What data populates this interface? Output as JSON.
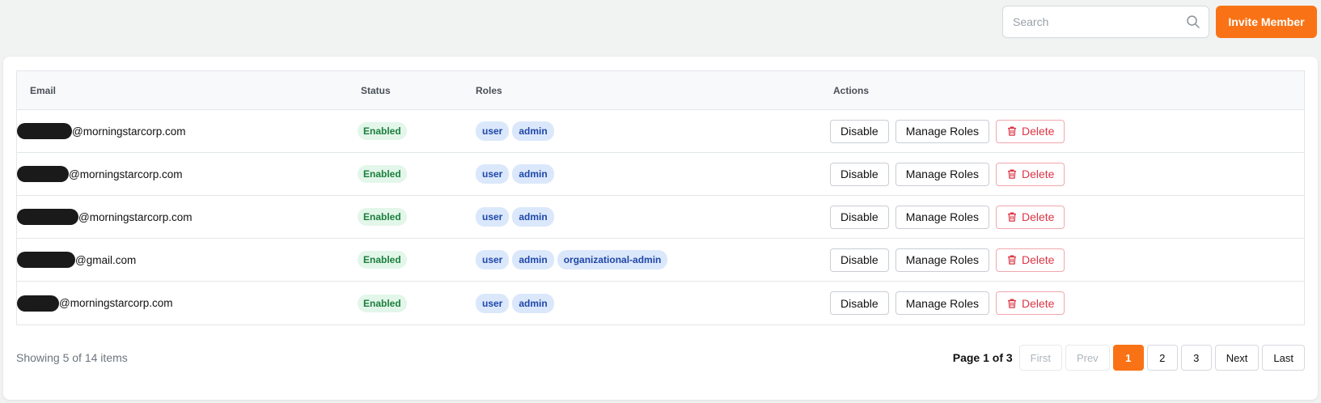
{
  "toolbar": {
    "search_placeholder": "Search",
    "invite_label": "Invite Member"
  },
  "table": {
    "headers": {
      "email": "Email",
      "status": "Status",
      "roles": "Roles",
      "actions": "Actions"
    },
    "actions": {
      "disable": "Disable",
      "manage_roles": "Manage Roles",
      "delete": "Delete"
    },
    "rows": [
      {
        "email_domain": "@morningstarcorp.com",
        "status": "Enabled",
        "roles": [
          "user",
          "admin"
        ]
      },
      {
        "email_domain": "@morningstarcorp.com",
        "status": "Enabled",
        "roles": [
          "user",
          "admin"
        ]
      },
      {
        "email_domain": "@morningstarcorp.com",
        "status": "Enabled",
        "roles": [
          "user",
          "admin"
        ]
      },
      {
        "email_domain": "@gmail.com",
        "status": "Enabled",
        "roles": [
          "user",
          "admin",
          "organizational-admin"
        ]
      },
      {
        "email_domain": "@morningstarcorp.com",
        "status": "Enabled",
        "roles": [
          "user",
          "admin"
        ]
      }
    ]
  },
  "footer": {
    "showing": "Showing 5 of 14 items",
    "page_info": "Page 1 of 3",
    "first": "First",
    "prev": "Prev",
    "pages": [
      "1",
      "2",
      "3"
    ],
    "next": "Next",
    "last": "Last"
  },
  "colors": {
    "accent": "#f97316",
    "status_bg": "#e3f6ea",
    "role_bg": "#dbe8fb",
    "danger": "#dc3545"
  },
  "icons": {
    "search": "search-icon",
    "delete": "trash-icon"
  }
}
